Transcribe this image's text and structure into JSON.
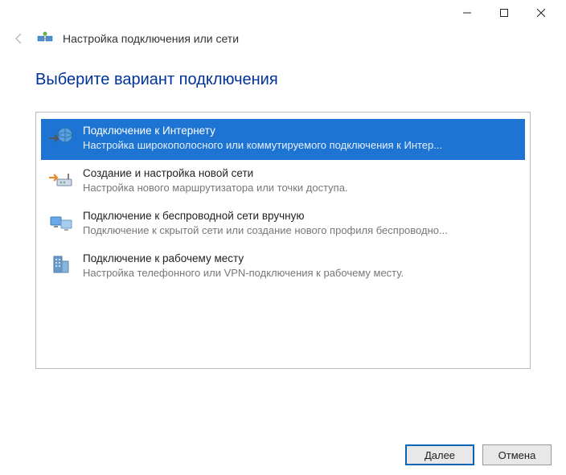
{
  "window": {
    "title": "Настройка подключения или сети"
  },
  "heading": "Выберите вариант подключения",
  "options": [
    {
      "title": "Подключение к Интернету",
      "desc": "Настройка широкополосного или коммутируемого подключения к Интер..."
    },
    {
      "title": "Создание и настройка новой сети",
      "desc": "Настройка нового маршрутизатора или точки доступа."
    },
    {
      "title": "Подключение к беспроводной сети вручную",
      "desc": "Подключение к скрытой сети или создание нового профиля беспроводно..."
    },
    {
      "title": "Подключение к рабочему месту",
      "desc": "Настройка телефонного или VPN-подключения к рабочему месту."
    }
  ],
  "buttons": {
    "next": "Далее",
    "cancel": "Отмена"
  }
}
